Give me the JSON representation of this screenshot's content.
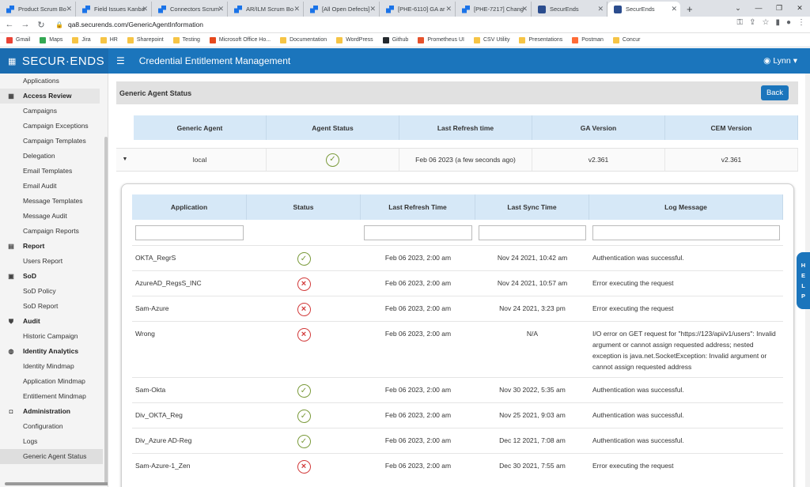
{
  "browser": {
    "tabs": [
      {
        "label": "Product Scrum Bo",
        "icon": "jira-icon"
      },
      {
        "label": "Field Issues Kanba",
        "icon": "jira-icon"
      },
      {
        "label": "Connectors Scrum",
        "icon": "jira-icon"
      },
      {
        "label": "AR/ILM Scrum Bo",
        "icon": "jira-icon"
      },
      {
        "label": "[All Open Defects]",
        "icon": "jira-icon"
      },
      {
        "label": "[PHE-6110] GA ar",
        "icon": "jira-icon"
      },
      {
        "label": "[PHE-7217] Chang",
        "icon": "jira-icon"
      },
      {
        "label": "SecurEnds",
        "icon": "securends-icon"
      },
      {
        "label": "SecurEnds",
        "icon": "securends-icon",
        "active": true
      }
    ],
    "url": "qa8.securends.com/GenericAgentInformation",
    "bookmarks": [
      {
        "label": "Gmail",
        "color": "#ea4335"
      },
      {
        "label": "Maps",
        "color": "#34a853"
      },
      {
        "label": "Jira",
        "color": "#f6c445"
      },
      {
        "label": "HR",
        "color": "#f6c445"
      },
      {
        "label": "Sharepoint",
        "color": "#f6c445"
      },
      {
        "label": "Testing",
        "color": "#f6c445"
      },
      {
        "label": "Microsoft Office Ho...",
        "color": "#e6491d"
      },
      {
        "label": "Documentation",
        "color": "#f6c445"
      },
      {
        "label": "WordPress",
        "color": "#f6c445"
      },
      {
        "label": "Github",
        "color": "#24292e"
      },
      {
        "label": "Prometheus UI",
        "color": "#e6522c"
      },
      {
        "label": "CSV Utility",
        "color": "#f6c445"
      },
      {
        "label": "Presentations",
        "color": "#f6c445"
      },
      {
        "label": "Postman",
        "color": "#ff6c37"
      },
      {
        "label": "Concur",
        "color": "#f6c445"
      }
    ]
  },
  "header": {
    "logo": "SECUR·ENDS",
    "title": "Credential Entitlement Management",
    "user": "Lynn"
  },
  "sidebar": {
    "items": [
      {
        "type": "item",
        "label": "Applications"
      },
      {
        "type": "head",
        "label": "Access Review",
        "icon": "grid-icon",
        "highlight": true
      },
      {
        "type": "item",
        "label": "Campaigns"
      },
      {
        "type": "item",
        "label": "Campaign Exceptions"
      },
      {
        "type": "item",
        "label": "Campaign Templates"
      },
      {
        "type": "item",
        "label": "Delegation"
      },
      {
        "type": "item",
        "label": "Email Templates"
      },
      {
        "type": "item",
        "label": "Email Audit"
      },
      {
        "type": "item",
        "label": "Message Templates"
      },
      {
        "type": "item",
        "label": "Message Audit"
      },
      {
        "type": "item",
        "label": "Campaign Reports"
      },
      {
        "type": "head",
        "label": "Report",
        "icon": "document-icon"
      },
      {
        "type": "item",
        "label": "Users Report"
      },
      {
        "type": "head",
        "label": "SoD",
        "icon": "sod-icon"
      },
      {
        "type": "item",
        "label": "SoD Policy"
      },
      {
        "type": "item",
        "label": "SoD Report"
      },
      {
        "type": "head",
        "label": "Audit",
        "icon": "shield-icon"
      },
      {
        "type": "item",
        "label": "Historic Campaign"
      },
      {
        "type": "head",
        "label": "Identity Analytics",
        "icon": "fingerprint-icon"
      },
      {
        "type": "item",
        "label": "Identity Mindmap"
      },
      {
        "type": "item",
        "label": "Application Mindmap"
      },
      {
        "type": "item",
        "label": "Entitlement Mindmap"
      },
      {
        "type": "head",
        "label": "Administration",
        "icon": "admin-icon"
      },
      {
        "type": "item",
        "label": "Configuration"
      },
      {
        "type": "item",
        "label": "Logs"
      },
      {
        "type": "item",
        "label": "Generic Agent Status",
        "selected": true
      }
    ]
  },
  "panel": {
    "title": "Generic Agent Status",
    "back_label": "Back"
  },
  "agent_table": {
    "headers": [
      "Generic Agent",
      "Agent Status",
      "Last Refresh time",
      "GA Version",
      "CEM Version"
    ],
    "row": {
      "agent": "local",
      "status": "ok",
      "last_refresh": "Feb 06 2023 (a few seconds ago)",
      "ga_version": "v2.361",
      "cem_version": "v2.361"
    }
  },
  "detail_table": {
    "headers": [
      "Application",
      "Status",
      "Last Refresh Time",
      "Last Sync Time",
      "Log Message"
    ],
    "rows": [
      {
        "application": "OKTA_RegrS",
        "status": "ok",
        "last_refresh": "Feb 06 2023, 2:00 am",
        "last_sync": "Nov 24 2021, 10:42 am",
        "log": "Authentication was successful."
      },
      {
        "application": "AzureAD_RegsS_INC",
        "status": "error",
        "last_refresh": "Feb 06 2023, 2:00 am",
        "last_sync": "Nov 24 2021, 10:57 am",
        "log": "Error executing the request"
      },
      {
        "application": "Sam-Azure",
        "status": "error",
        "last_refresh": "Feb 06 2023, 2:00 am",
        "last_sync": "Nov 24 2021, 3:23 pm",
        "log": "Error executing the request"
      },
      {
        "application": "Wrong",
        "status": "error",
        "last_refresh": "Feb 06 2023, 2:00 am",
        "last_sync": "N/A",
        "log": "I/O error on GET request for \"https://123/api/v1/users\": Invalid argument or cannot assign requested address; nested exception is java.net.SocketException: Invalid argument or cannot assign requested address"
      },
      {
        "application": "Sam-Okta",
        "status": "ok",
        "last_refresh": "Feb 06 2023, 2:00 am",
        "last_sync": "Nov 30 2022, 5:35 am",
        "log": "Authentication was successful."
      },
      {
        "application": "Div_OKTA_Reg",
        "status": "ok",
        "last_refresh": "Feb 06 2023, 2:00 am",
        "last_sync": "Nov 25 2021, 9:03 am",
        "log": "Authentication was successful."
      },
      {
        "application": "Div_Azure AD-Reg",
        "status": "ok",
        "last_refresh": "Feb 06 2023, 2:00 am",
        "last_sync": "Dec 12 2021, 7:08 am",
        "log": "Authentication was successful."
      },
      {
        "application": "Sam-Azure-1_Zen",
        "status": "error",
        "last_refresh": "Feb 06 2023, 2:00 am",
        "last_sync": "Dec 30 2021, 7:55 am",
        "log": "Error executing the request"
      }
    ]
  },
  "help_label": [
    "H",
    "E",
    "L",
    "P"
  ],
  "colors": {
    "brand": "#1b75bc",
    "ok": "#7a9a3a",
    "error": "#d23b3b",
    "table_header": "#d6e8f7"
  }
}
